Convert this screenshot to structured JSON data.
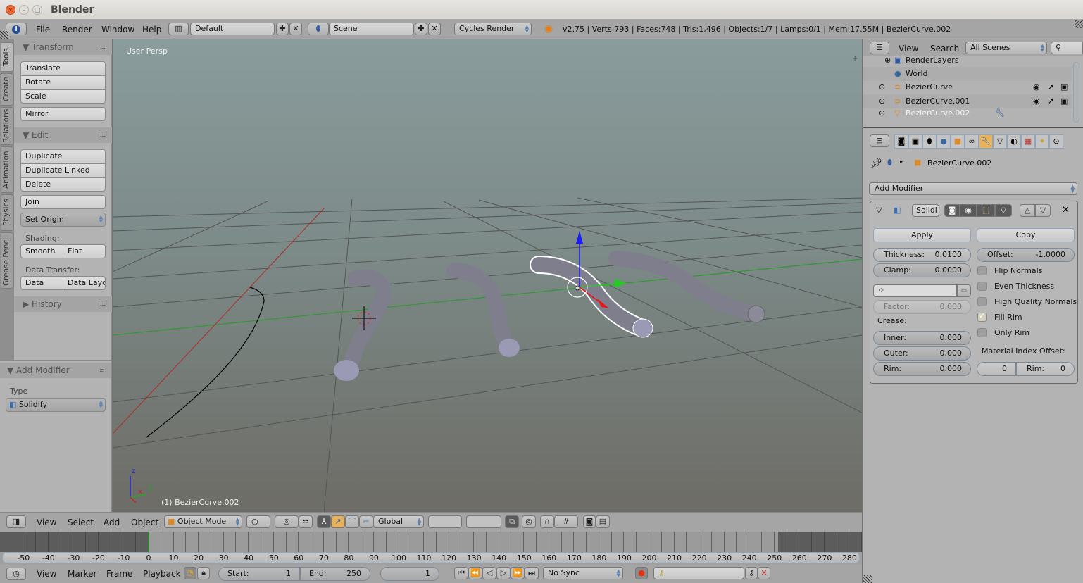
{
  "window": {
    "title": "Blender",
    "close": "×",
    "minimize": "–",
    "maximize": "□"
  },
  "infobar": {
    "menus": [
      "File",
      "Render",
      "Window",
      "Help"
    ],
    "screen_layout": "Default",
    "scene": "Scene",
    "render_engine": "Cycles Render",
    "status": "v2.75 | Verts:793 | Faces:748 | Tris:1,496 | Objects:1/7 | Lamps:0/1 | Mem:17.55M | BezierCurve.002"
  },
  "toolshelf": {
    "tabs": [
      "Tools",
      "Create",
      "Relations",
      "Animation",
      "Physics",
      "Grease Pencil"
    ],
    "active_tab": "Tools",
    "transform": {
      "title": "Transform",
      "buttons": [
        "Translate",
        "Rotate",
        "Scale"
      ],
      "mirror": "Mirror"
    },
    "edit": {
      "title": "Edit",
      "buttons": [
        "Duplicate",
        "Duplicate Linked",
        "Delete"
      ],
      "join": "Join",
      "set_origin": "Set Origin",
      "shading_label": "Shading:",
      "smooth": "Smooth",
      "flat": "Flat",
      "data_transfer_label": "Data Transfer:",
      "data": "Data",
      "data_layout": "Data Layo"
    },
    "history": {
      "title": "History"
    }
  },
  "operator_panel": {
    "title": "Add Modifier",
    "type_label": "Type",
    "type_value": "Solidify"
  },
  "viewport": {
    "view_label": "User Persp",
    "object_label": "(1) BezierCurve.002",
    "axis_labels": {
      "x": "x",
      "y": "y",
      "z": "z"
    }
  },
  "view3d_header": {
    "menus": [
      "View",
      "Select",
      "Add",
      "Object"
    ],
    "mode": "Object Mode",
    "orientation": "Global"
  },
  "timeline": {
    "ticks": [
      -50,
      -40,
      -30,
      -20,
      -10,
      0,
      10,
      20,
      30,
      40,
      50,
      60,
      70,
      80,
      90,
      100,
      110,
      120,
      130,
      140,
      150,
      160,
      170,
      180,
      190,
      200,
      210,
      220,
      230,
      240,
      250,
      260,
      270,
      280
    ],
    "menus": [
      "View",
      "Marker",
      "Frame",
      "Playback"
    ],
    "start_label": "Start:",
    "start": "1",
    "end_label": "End:",
    "end": "250",
    "current_frame": "1",
    "sync": "No Sync"
  },
  "outliner": {
    "menus": [
      "View",
      "Search"
    ],
    "filter": "All Scenes",
    "rows": [
      {
        "name": "RenderLayers"
      },
      {
        "name": "World"
      },
      {
        "name": "BezierCurve"
      },
      {
        "name": "BezierCurve.001"
      },
      {
        "name": "BezierCurve.002"
      }
    ]
  },
  "properties": {
    "context_object": "BezierCurve.002",
    "add_modifier": "Add Modifier",
    "modifier": {
      "name": "Solidi",
      "apply": "Apply",
      "copy": "Copy",
      "thickness_label": "Thickness:",
      "thickness": "0.0100",
      "offset_label": "Offset:",
      "offset": "-1.0000",
      "clamp_label": "Clamp:",
      "clamp": "0.0000",
      "factor_label": "Factor:",
      "factor": "0.000",
      "crease_label": "Crease:",
      "inner_label": "Inner:",
      "inner": "0.000",
      "outer_label": "Outer:",
      "outer": "0.000",
      "rim_label": "Rim:",
      "rim": "0.000",
      "checkboxes": [
        {
          "label": "Flip Normals",
          "checked": false
        },
        {
          "label": "Even Thickness",
          "checked": false
        },
        {
          "label": "High Quality Normals",
          "checked": false
        },
        {
          "label": "Fill Rim",
          "checked": true
        },
        {
          "label": "Only Rim",
          "checked": false
        }
      ],
      "material_offset_label": "Material Index Offset:",
      "material_offset": "0",
      "material_rim_label": "Rim:",
      "material_rim": "0"
    }
  }
}
